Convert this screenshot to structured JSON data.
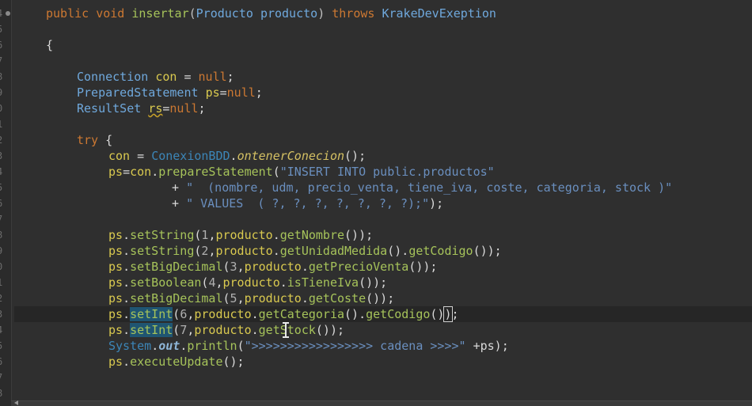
{
  "gutter": {
    "line_numbers": [
      "4",
      "5",
      "6",
      "7",
      "8",
      "9",
      "0",
      "1",
      "2",
      "3",
      "4",
      "5",
      "6",
      "7",
      "8",
      "9",
      "0",
      "1",
      "2",
      "3",
      "4",
      "5",
      "6",
      "7",
      "8"
    ]
  },
  "code": {
    "method_line": {
      "kw_public": "public",
      "kw_void": "void",
      "name": "insertar",
      "paren_open": "(",
      "param_type": "Producto",
      "param_name": "producto",
      "paren_close": ")",
      "kw_throws": "throws",
      "exception": "KrakeDevExeption"
    },
    "open_brace": "{",
    "decl_con": {
      "type": "Connection",
      "name": "con",
      "op": " = ",
      "value": "null",
      "end": ";"
    },
    "decl_ps": {
      "type": "PreparedStatement",
      "name": "ps",
      "op": "=",
      "value": "null",
      "end": ";"
    },
    "decl_rs": {
      "type": "ResultSet",
      "name": "rs",
      "op": "=",
      "value": "null",
      "end": ";"
    },
    "try_line": {
      "kw": "try",
      "brace": " {"
    },
    "con_assign": {
      "name": "con",
      "op": " = ",
      "cls": "ConexionBDD",
      "dot": ".",
      "method": "ontenerConecion",
      "end": "();"
    },
    "prepare_line": {
      "name": "ps",
      "op": "=",
      "obj": "con",
      "dot": ".",
      "method": "prepareStatement",
      "paren": "(",
      "sql1": "\"INSERT INTO public.productos\""
    },
    "concat_1": {
      "plus": "+ ",
      "sql2": "\"  (nombre, udm, precio_venta, tiene_iva, coste, categoria, stock )\""
    },
    "concat_2": {
      "plus": "+ ",
      "sql3": "\" VALUES  ( ?, ?, ?, ?, ?, ?, ?);\"",
      "end": ");"
    },
    "set1": {
      "obj": "ps",
      "dot": ".",
      "m": "setString",
      "open": "(",
      "idx": "1",
      "comma": ",",
      "p": "producto",
      "dot2": ".",
      "getter": "getNombre",
      "end": "());"
    },
    "set2": {
      "obj": "ps",
      "dot": ".",
      "m": "setString",
      "open": "(",
      "idx": "2",
      "comma": ",",
      "p": "producto",
      "dot2": ".",
      "getter": "getUnidadMedida",
      "mid": "().",
      "getter2": "getCodigo",
      "end": "());"
    },
    "set3": {
      "obj": "ps",
      "dot": ".",
      "m": "setBigDecimal",
      "open": "(",
      "idx": "3",
      "comma": ",",
      "p": "producto",
      "dot2": ".",
      "getter": "getPrecioVenta",
      "end": "());"
    },
    "set4": {
      "obj": "ps",
      "dot": ".",
      "m": "setBoolean",
      "open": "(",
      "idx": "4",
      "comma": ",",
      "p": "producto",
      "dot2": ".",
      "getter": "isTieneIva",
      "end": "());"
    },
    "set5": {
      "obj": "ps",
      "dot": ".",
      "m": "setBigDecimal",
      "open": "(",
      "idx": "5",
      "comma": ",",
      "p": "producto",
      "dot2": ".",
      "getter": "getCoste",
      "end": "());"
    },
    "set6": {
      "obj": "ps",
      "dot": ".",
      "m": "setInt",
      "open": "(",
      "idx": "6",
      "comma": ",",
      "p": "producto",
      "dot2": ".",
      "getter": "getCategoria",
      "mid": "().",
      "getter2": "getCodigo",
      "paren_a": "()",
      "paren_b": ")",
      "end": ";"
    },
    "set7": {
      "obj": "ps",
      "dot": ".",
      "m": "setInt",
      "open": "(",
      "idx": "7",
      "comma": ",",
      "p": "producto",
      "dot2": ".",
      "getter": "getStock",
      "end": "());"
    },
    "println": {
      "cls": "System",
      "dot": ".",
      "field": "out",
      "dot2": ".",
      "m": "println",
      "open": "(",
      "str": "\">>>>>>>>>>>>>>>>> cadena >>>>\"",
      "rest": " +ps);"
    },
    "exec": {
      "obj": "ps",
      "dot": ".",
      "m": "executeUpdate",
      "end": "();"
    }
  },
  "icons": {
    "cursor": "text-ibeam-icon",
    "fold": "fold-marker-icon"
  },
  "colors": {
    "background": "#2f2f2f",
    "keyword": "#cc7832",
    "method": "#a6c35a",
    "type": "#6fa8dc",
    "variable": "#d9c94f",
    "string": "#6a8fbf",
    "selection": "#1f5572"
  }
}
